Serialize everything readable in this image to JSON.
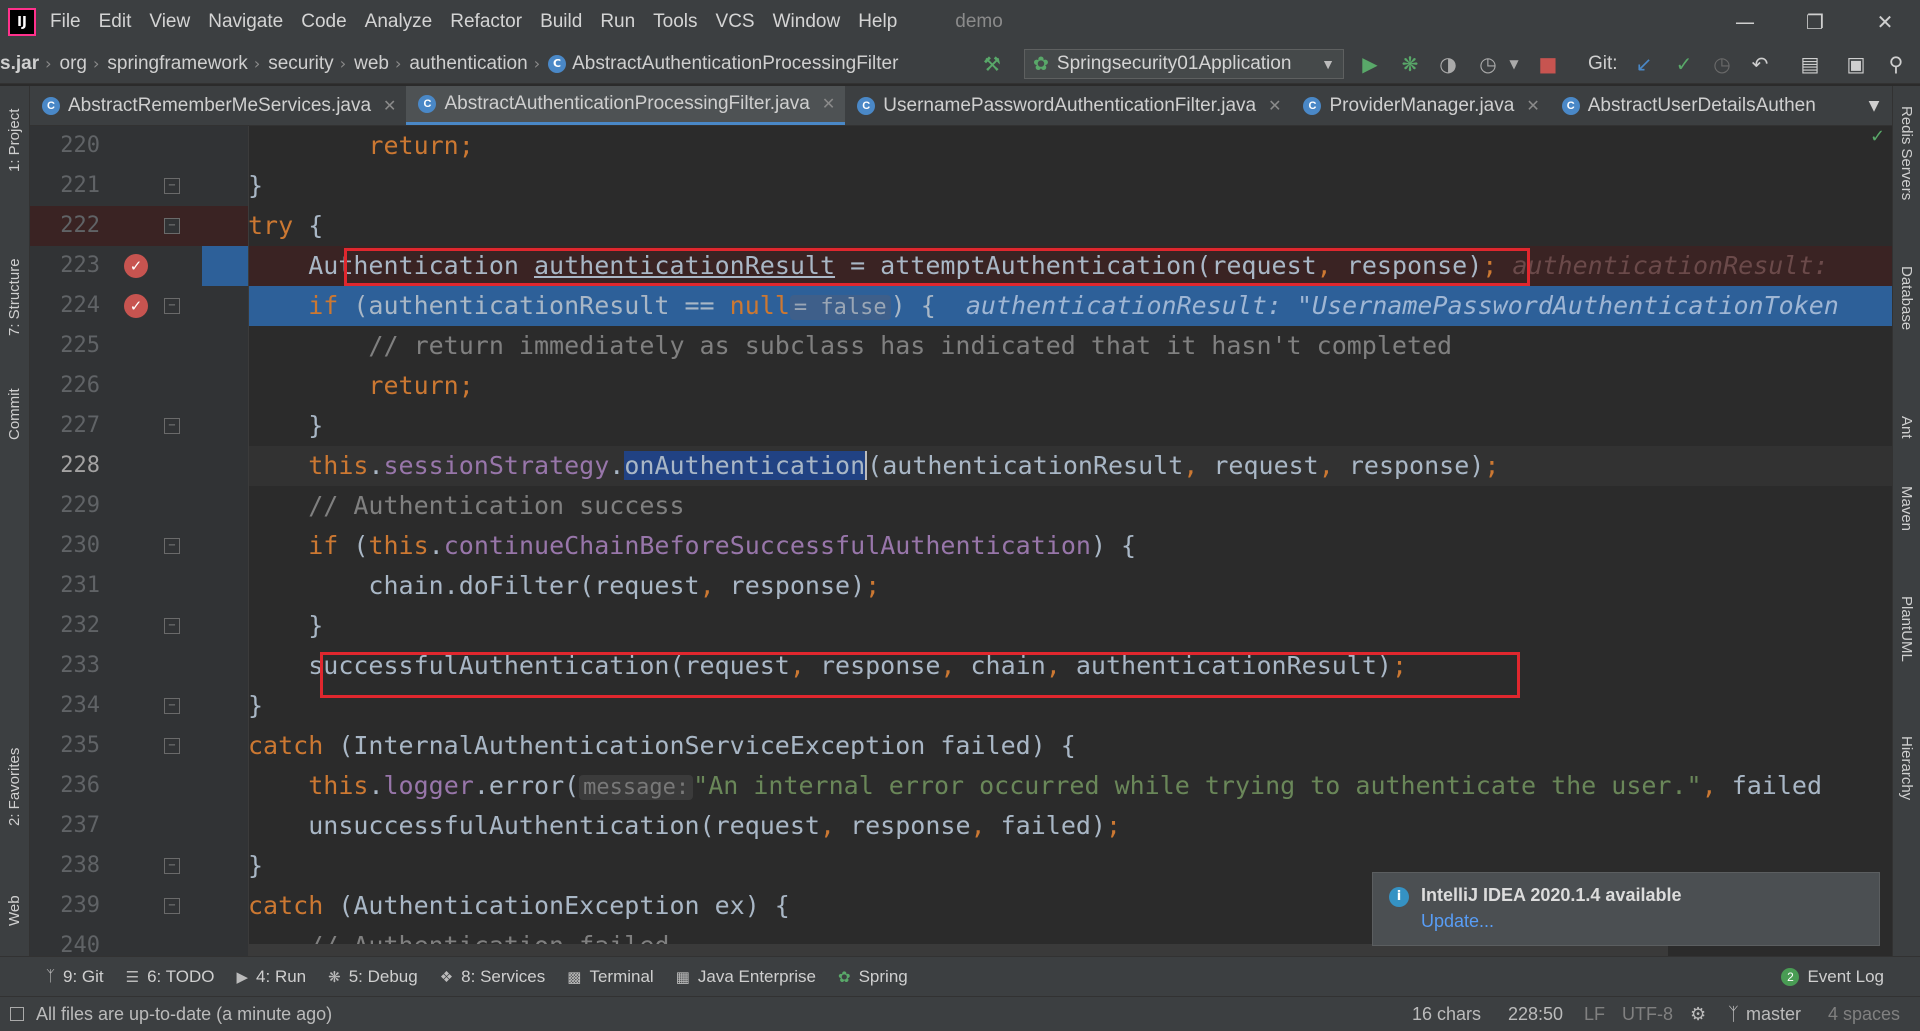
{
  "menubar": {
    "logo_text": "IJ",
    "items": [
      "File",
      "Edit",
      "View",
      "Navigate",
      "Code",
      "Analyze",
      "Refactor",
      "Build",
      "Run",
      "Tools",
      "VCS",
      "Window",
      "Help"
    ],
    "project": "demo"
  },
  "navbar": {
    "crumbs": [
      "s.jar",
      "org",
      "springframework",
      "security",
      "web",
      "authentication",
      "AbstractAuthenticationProcessingFilter"
    ],
    "run_config": "Springsecurity01Application",
    "git_label": "Git:"
  },
  "tabs": [
    {
      "label": "AbstractRememberMeServices.java",
      "active": false,
      "closable": true
    },
    {
      "label": "AbstractAuthenticationProcessingFilter.java",
      "active": true,
      "closable": true
    },
    {
      "label": "UsernamePasswordAuthenticationFilter.java",
      "active": false,
      "closable": true
    },
    {
      "label": "ProviderManager.java",
      "active": false,
      "closable": true
    },
    {
      "label": "AbstractUserDetailsAuthen",
      "active": false,
      "closable": false
    }
  ],
  "left_strip": {
    "project": "1: Project",
    "structure": "7: Structure",
    "commit": "Commit",
    "favorites": "2: Favorites",
    "web": "Web"
  },
  "right_strip": {
    "redis": "Redis Servers",
    "database": "Database",
    "ant": "Ant",
    "maven": "Maven",
    "plantuml": "PlantUML",
    "hierarchy": "Hierarchy"
  },
  "editor": {
    "line_numbers": [
      "220",
      "221",
      "222",
      "223",
      "224",
      "225",
      "226",
      "227",
      "228",
      "229",
      "230",
      "231",
      "232",
      "233",
      "234",
      "235",
      "236",
      "237",
      "238",
      "239",
      "240"
    ],
    "current_line": "228",
    "execution_line": "224",
    "breakpoint_lines": [
      "223",
      "224"
    ],
    "code": {
      "l220_return": "return;",
      "l221_brace": "}",
      "l222_try": "try",
      "l222_brace": " {",
      "l223_type": "Authentication ",
      "l223_var": "authenticationResult",
      "l223_mid": " = attemptAuthentication(request",
      "l223_comma": ",",
      "l223_end": " response)",
      "l223_semi": ";",
      "l223_hint": "authenticationResult: ",
      "l224_if": "if",
      "l224_cond": " (authenticationResult == ",
      "l224_null": "null",
      "l224_eval": "= false",
      "l224_close": ") {",
      "l224_hint": "authenticationResult: \"UsernamePasswordAuthenticationToken",
      "l225_comment": "// return immediately as subclass has indicated that it hasn't completed",
      "l226_return": "return;",
      "l227_brace": "}",
      "l228_this": "this",
      "l228_dot": ".",
      "l228_field": "sessionStrategy",
      "l228_dot2": ".",
      "l228_method": "onAuthentication",
      "l228_args": "(authenticationResult",
      "l228_c1": ",",
      "l228_req": " request",
      "l228_c2": ",",
      "l228_resp": " response)",
      "l228_semi": ";",
      "l229_comment": "// Authentication success",
      "l230_if": "if",
      "l230_open": " (",
      "l230_this": "this",
      "l230_dot": ".",
      "l230_field": "continueChainBeforeSuccessfulAuthentication",
      "l230_close": ") {",
      "l231_call": "chain.doFilter(request",
      "l231_c": ",",
      "l231_end": " response)",
      "l231_semi": ";",
      "l232_brace": "}",
      "l233_call": "successfulAuthentication(request",
      "l233_c1": ",",
      "l233_resp": " response",
      "l233_c2": ",",
      "l233_chain": " chain",
      "l233_c3": ",",
      "l233_end": " authenticationResult)",
      "l233_semi": ";",
      "l234_brace": "}",
      "l235_catch": "catch",
      "l235_rest": " (InternalAuthenticationServiceException failed) {",
      "l236_this": "this",
      "l236_dot": ".",
      "l236_field": "logger",
      "l236_call": ".error(",
      "l236_hint": "message:",
      "l236_str": "\"An internal error occurred while trying to authenticate the user.\"",
      "l236_c": ",",
      "l236_end": " failed",
      "l237_call": "unsuccessfulAuthentication(request",
      "l237_c1": ",",
      "l237_resp": " response",
      "l237_c2": ",",
      "l237_end": " failed)",
      "l237_semi": ";",
      "l238_brace": "}",
      "l239_catch": "catch",
      "l239_rest": " (AuthenticationException ex) {",
      "l240_comment": "// Authentication failed"
    }
  },
  "notification": {
    "title": "IntelliJ IDEA 2020.1.4 available",
    "link": "Update..."
  },
  "toolwindows": [
    {
      "label": "9: Git",
      "icon": "git-icon"
    },
    {
      "label": "6: TODO",
      "icon": "todo-icon"
    },
    {
      "label": "4: Run",
      "icon": "run-icon"
    },
    {
      "label": "5: Debug",
      "icon": "debug-icon"
    },
    {
      "label": "8: Services",
      "icon": "services-icon"
    },
    {
      "label": "Terminal",
      "icon": "terminal-icon"
    },
    {
      "label": "Java Enterprise",
      "icon": "java-enterprise-icon"
    },
    {
      "label": "Spring",
      "icon": "spring-icon"
    }
  ],
  "event_log": {
    "count": "2",
    "label": "Event Log"
  },
  "status": {
    "message": "All files are up-to-date (a minute ago)",
    "chars": "16 chars",
    "position": "228:50",
    "line_sep": "LF",
    "encoding": "UTF-8",
    "branch": "master",
    "indent": "4 spaces"
  },
  "colors": {
    "accent": "#4a88c7",
    "breakpoint": "#c75450",
    "annotation_box": "#e0272e",
    "selection": "#214283",
    "exec_line": "#2d6099"
  }
}
